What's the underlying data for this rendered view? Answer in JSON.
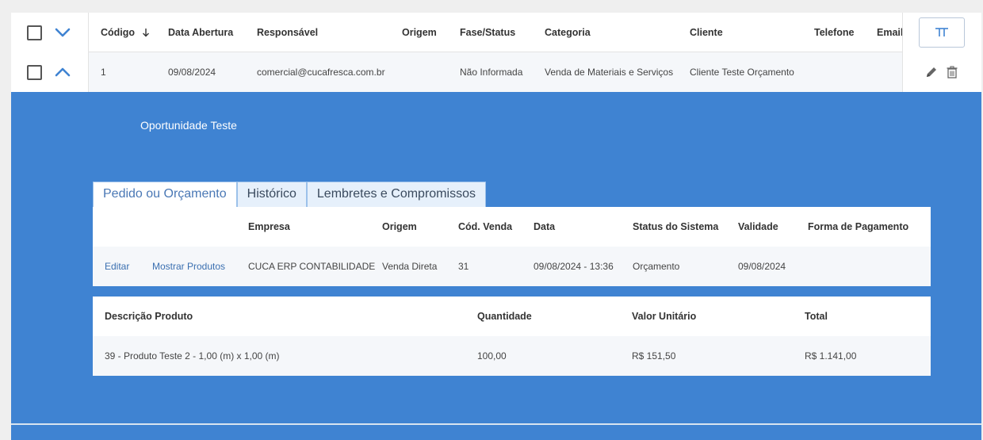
{
  "grid": {
    "headers": {
      "codigo": "Código",
      "data_abertura": "Data Abertura",
      "responsavel": "Responsável",
      "origem": "Origem",
      "fase_status": "Fase/Status",
      "categoria": "Categoria",
      "cliente": "Cliente",
      "telefone": "Telefone",
      "email": "Email"
    },
    "sort_icon": "arrow-down-icon",
    "column_chooser_icon": "columns-icon",
    "row": {
      "codigo": "1",
      "data_abertura": "09/08/2024",
      "responsavel": "comercial@cucafresca.com.br",
      "origem": "",
      "fase_status": "Não Informada",
      "categoria": "Venda de Materiais e Serviços",
      "cliente": "Cliente Teste Orçamento",
      "telefone": "",
      "email": ""
    },
    "row_actions": [
      "pencil-icon",
      "trash-icon"
    ]
  },
  "detail": {
    "title": "Oportunidade Teste",
    "tabs": [
      "Pedido ou Orçamento",
      "Histórico",
      "Lembretes e Compromissos"
    ],
    "active_tab": 0,
    "orders": {
      "headers": {
        "empresa": "Empresa",
        "origem": "Origem",
        "cod_venda": "Cód. Venda",
        "data": "Data",
        "status_sistema": "Status do Sistema",
        "validade": "Validade",
        "forma_pagamento": "Forma de Pagamento"
      },
      "row": {
        "editar": "Editar",
        "mostrar_produtos": "Mostrar Produtos",
        "empresa": "CUCA ERP CONTABILIDADE",
        "origem": "Venda Direta",
        "cod_venda": "31",
        "data": "09/08/2024 - 13:36",
        "status_sistema": "Orçamento",
        "validade": "09/08/2024"
      }
    },
    "products": {
      "headers": {
        "descricao": "Descrição Produto",
        "quantidade": "Quantidade",
        "valor_unitario": "Valor Unitário",
        "total": "Total"
      },
      "row": {
        "descricao": "39 - Produto Teste 2 - 1,00 (m) x 1,00 (m)",
        "quantidade": "100,00",
        "valor_unitario": "R$ 151,50",
        "total": "R$ 1.141,00"
      }
    }
  },
  "colors": {
    "accent_blue": "#3f83d2",
    "link_blue": "#3a6fb0",
    "row_alt": "#f5f7fa"
  }
}
